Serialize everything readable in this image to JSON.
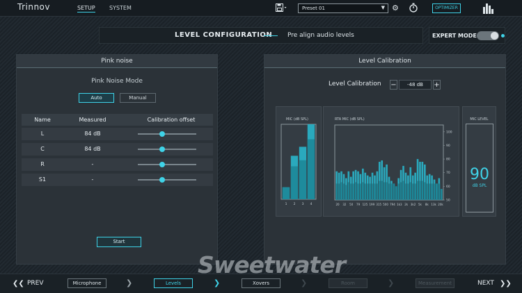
{
  "topbar": {
    "logo": "Trinnov",
    "nav": [
      "SETUP",
      "SYSTEM"
    ],
    "preset": "Preset 01",
    "optimizer_label": "OPTIMIZER"
  },
  "header": {
    "title": "LEVEL CONFIGURATION",
    "subtitle": "Pre align audio levels",
    "expert_mode": "EXPERT MODE",
    "expert_mode_on": true
  },
  "pink_noise": {
    "title": "Pink noise",
    "mode_label": "Pink Noise Mode",
    "modes": [
      "Auto",
      "Manual"
    ],
    "active_mode": "Auto",
    "columns": [
      "Name",
      "Measured",
      "Calibration offset"
    ],
    "rows": [
      {
        "name": "L",
        "measured": "84 dB",
        "offset": 0.42
      },
      {
        "name": "C",
        "measured": "84 dB",
        "offset": 0.42
      },
      {
        "name": "R",
        "measured": "-",
        "offset": 0.42
      },
      {
        "name": "S1",
        "measured": "-",
        "offset": 0.42
      }
    ],
    "start_label": "Start"
  },
  "level_calibration": {
    "title": "Level Calibration",
    "label": "Level Calibration",
    "value": "-48 dB",
    "minus": "−",
    "plus": "+"
  },
  "chart_data": [
    {
      "type": "bar",
      "title": "MIC (dB SPL)",
      "categories": [
        "1",
        "2",
        "3",
        "4"
      ],
      "series": [
        {
          "values": [
            58,
            79,
            85,
            100
          ]
        },
        {
          "values": [
            58,
            72,
            76,
            90
          ]
        }
      ],
      "ylim": [
        50,
        100
      ]
    },
    {
      "type": "bar",
      "title": "RTA MIC (dB SPL)",
      "categories": [
        "20",
        "32",
        "50",
        "79",
        "125",
        "199",
        "315",
        "500",
        "794",
        "1k3",
        "2k",
        "3k2",
        "5k",
        "8k",
        "13k",
        "20k"
      ],
      "x_ticks": [
        "20",
        "32",
        "50",
        "79",
        "125",
        "199",
        "315",
        "500",
        "794",
        "1k3",
        "2k",
        "3k2",
        "5k",
        "8k",
        "13k",
        "20k"
      ],
      "y_ticks": [
        50,
        60,
        70,
        80,
        90,
        100
      ],
      "series": [
        {
          "values": [
            71,
            70,
            71,
            69,
            66,
            71,
            67,
            71,
            72,
            71,
            69,
            73,
            70,
            68,
            67,
            70,
            68,
            71,
            78,
            79,
            74,
            76,
            67,
            64,
            62,
            60,
            66,
            72,
            75,
            70,
            68,
            74,
            68,
            70,
            80,
            78,
            78,
            76,
            68,
            69,
            68,
            65,
            62,
            66,
            58
          ]
        },
        {
          "values": [
            62,
            62,
            63,
            62,
            61,
            63,
            62,
            62,
            63,
            62,
            62,
            63,
            62,
            62,
            62,
            62,
            62,
            62,
            64,
            64,
            63,
            63,
            62,
            62,
            62,
            60,
            62,
            63,
            64,
            62,
            62,
            63,
            62,
            62,
            64,
            64,
            64,
            63,
            62,
            62,
            62,
            62,
            62,
            62,
            58
          ]
        }
      ],
      "ylim": [
        50,
        105
      ]
    }
  ],
  "mic_level": {
    "title": "MIC LEVEL",
    "value": "90",
    "unit": "dB SPL"
  },
  "bottom_nav": {
    "prev": "PREV",
    "next": "NEXT",
    "steps": [
      {
        "label": "Microphone",
        "state": "normal"
      },
      {
        "label": "Levels",
        "state": "active"
      },
      {
        "label": "Xovers",
        "state": "normal"
      },
      {
        "label": "Room",
        "state": "dim"
      },
      {
        "label": "Measurement",
        "state": "dim"
      }
    ]
  },
  "watermark": "Sweetwater",
  "colors": {
    "accent": "#3fd3e8",
    "panel": "#2b3238",
    "background": "#1b2228"
  }
}
